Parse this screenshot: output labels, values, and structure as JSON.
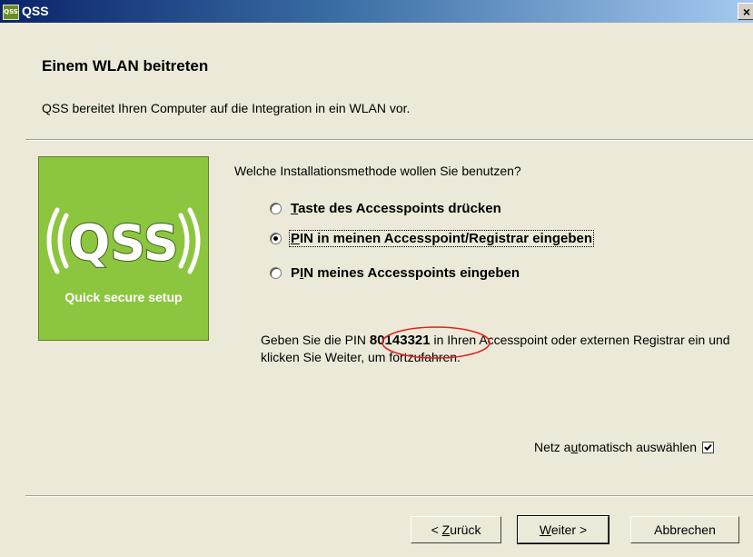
{
  "window": {
    "title": "QSS",
    "app_icon_text": "QSS",
    "close_glyph": "×"
  },
  "header": {
    "title": "Einem WLAN beitreten",
    "description": "QSS bereitet Ihren Computer auf die Integration in ein WLAN vor."
  },
  "logo": {
    "text": "QSS",
    "caption": "Quick secure setup",
    "background": "#8cc63f"
  },
  "question": "Welche Installationsmethode wollen Sie benutzen?",
  "options": [
    {
      "label_mn": "T",
      "label_rest": "aste des Accesspoints drücken",
      "checked": false
    },
    {
      "label_mn": "P",
      "label_rest": "IN in meinen Accesspoint/Registrar eingeben",
      "checked": true
    },
    {
      "label_mn": "I",
      "label_pre": "P",
      "label_rest": "N meines Accesspoints eingeben",
      "checked": false
    }
  ],
  "pin_instruction": {
    "before": "Geben Sie die PIN ",
    "pin": "80143321",
    "after": " in Ihren Accesspoint oder externen Registrar ein und klicken Sie Weiter, um fortzufahren."
  },
  "auto_select": {
    "label_pre": "Netz a",
    "label_mn": "u",
    "label_rest": "tomatisch auswählen",
    "checked": true
  },
  "buttons": {
    "back": {
      "pre": "< ",
      "mn": "Z",
      "rest": "urück"
    },
    "next": {
      "pre": "",
      "mn": "W",
      "rest": "eiter >"
    },
    "cancel": "Abbrechen"
  },
  "annotation_color": "#e02020"
}
